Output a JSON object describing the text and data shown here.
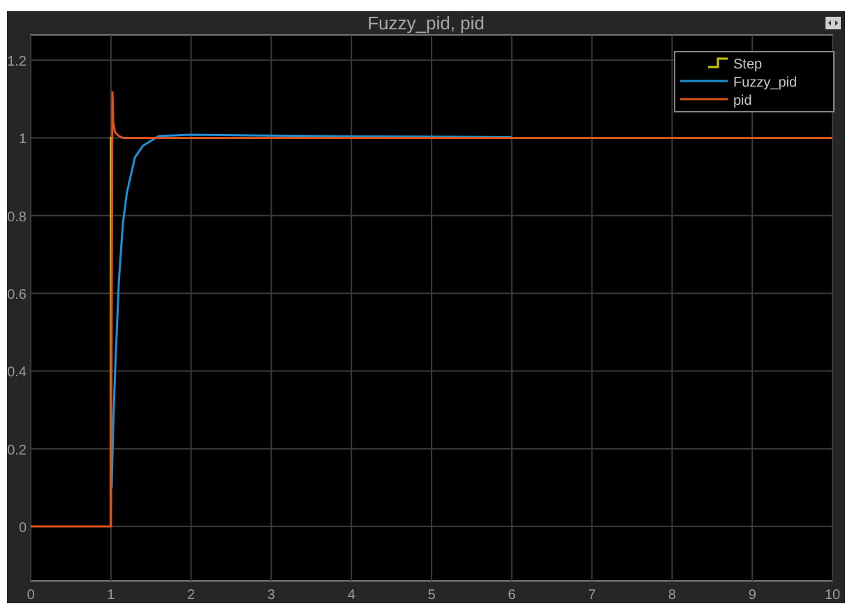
{
  "window": {
    "title": "Fuzzy_pid, pid"
  },
  "plot": {
    "chart_data": {
      "type": "line",
      "grid": true,
      "legend": true,
      "x": [
        0,
        0.999,
        1,
        1.01,
        1.02,
        1.03,
        1.05,
        1.1,
        1.15,
        1.2,
        1.3,
        1.4,
        1.6,
        2,
        3,
        4,
        5,
        6,
        7,
        8,
        9,
        10
      ],
      "xlim": [
        0,
        10
      ],
      "ylim": [
        -0.14,
        1.265
      ],
      "xticks": [
        0,
        1,
        2,
        3,
        4,
        5,
        6,
        7,
        8,
        9,
        10
      ],
      "yticks": [
        0,
        0.2,
        0.4,
        0.6,
        0.8,
        1,
        1.2
      ],
      "series": [
        {
          "name": "Step",
          "color": "#c8c800",
          "values": [
            null,
            0,
            1,
            1,
            1,
            1,
            null,
            null,
            null,
            null,
            null,
            null,
            null,
            null,
            null,
            null,
            null,
            null,
            null,
            null,
            null,
            null
          ]
        },
        {
          "name": "Fuzzy_pid",
          "color": "#1f8fd6",
          "values": [
            null,
            null,
            null,
            0.1,
            0.18,
            0.26,
            0.39,
            0.63,
            0.78,
            0.86,
            0.95,
            0.98,
            1.005,
            1.008,
            1.006,
            1.004,
            1.003,
            1.002,
            null,
            null,
            null,
            null
          ]
        },
        {
          "name": "pid",
          "color": "#d9541a",
          "values": [
            0,
            0,
            0,
            0.6,
            1.12,
            1.04,
            1.015,
            1.005,
            1,
            1,
            1,
            1,
            1,
            1,
            1,
            1,
            1,
            1,
            1,
            1,
            1,
            1
          ]
        }
      ]
    }
  }
}
